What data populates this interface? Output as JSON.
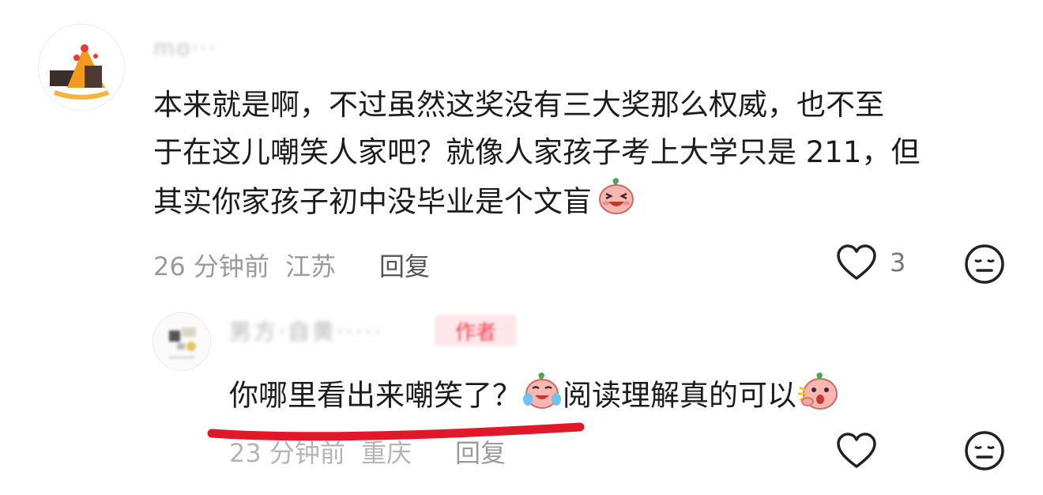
{
  "comment": {
    "username": "mo···",
    "text_lines": [
      "本来就是啊，不过虽然这奖没有三大奖那么权威，也不至",
      "于在这儿嘲笑人家吧？就像人家孩子考上大学只是 211，但",
      "其实你家孩子初中没毕业是个文盲"
    ],
    "time": "26 分钟前",
    "location": "江苏",
    "reply_label": "回复",
    "like_count": "3"
  },
  "reply": {
    "username": "男方·自黄·····",
    "author_badge": "作者",
    "text_part1": "你哪里看出来嘲笑了？",
    "text_part2": "阅读理解真的可以",
    "time": "23 分钟前",
    "location": "重庆",
    "reply_label": "回复"
  },
  "icons": {
    "like": "heart-outline-icon",
    "dislike": "meh-face-icon",
    "emoji_laugh": "laughing-emoji-icon",
    "emoji_cry_laugh": "tears-of-joy-emoji-icon",
    "emoji_shock": "shocked-emoji-icon"
  },
  "colors": {
    "text": "#1c1c1c",
    "meta": "#9a9a9a",
    "underline": "#e0182a",
    "badge_bg": "#fde7ea",
    "badge_text": "#f0404f"
  }
}
